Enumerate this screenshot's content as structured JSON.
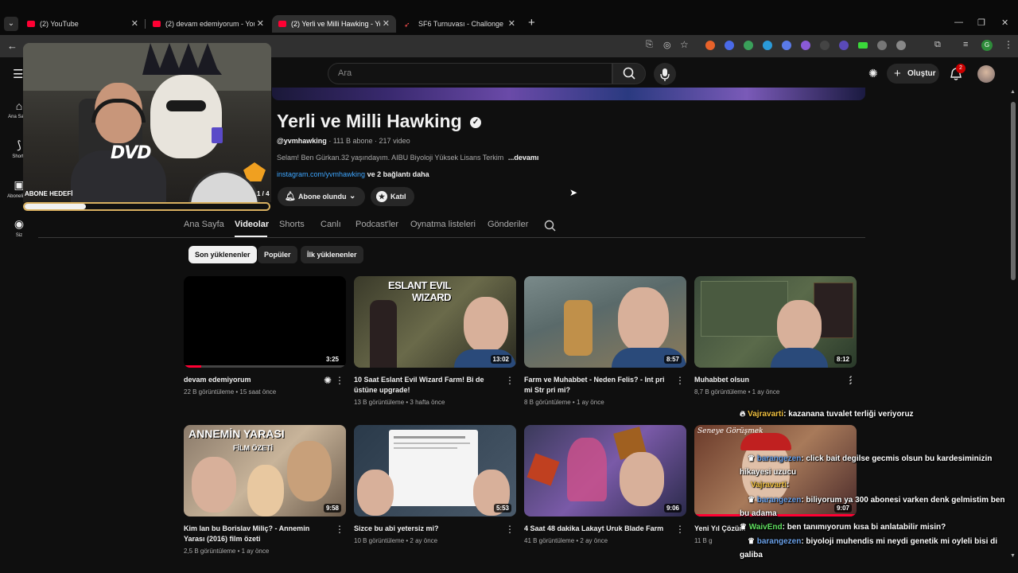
{
  "browser": {
    "tabs": [
      {
        "label": "(2) YouTube"
      },
      {
        "label": "(2) devam edemiyorum - YouTube"
      },
      {
        "label": "(2) Yerli ve Milli Hawking - YouTube"
      },
      {
        "label": "SF6 Turnuvası - Challonge"
      }
    ],
    "close_glyph": "✕",
    "new_tab_glyph": "+"
  },
  "youtube": {
    "search_placeholder": "Ara",
    "create_label": "Oluştur",
    "notification_count": "2",
    "sidebar": [
      {
        "label": "Ana Sayfa",
        "icon": "home-icon"
      },
      {
        "label": "Shorts",
        "icon": "shorts-icon"
      },
      {
        "label": "Abonelikler",
        "icon": "subscriptions-icon"
      },
      {
        "label": "Siz",
        "icon": "you-icon"
      }
    ]
  },
  "overlay": {
    "sub_goal_label": "ABONE HEDEFİ",
    "sub_goal_count": "1 / 4",
    "sub_goal_progress": 0.25,
    "dvd_logo": "DVD"
  },
  "channel": {
    "name": "Yerli ve Milli Hawking",
    "handle": "@yvmhawking",
    "subscribers": "111 B abone",
    "video_count": "217 video",
    "description": "Selam! Ben Gürkan.32 yaşındayım. AIBU Biyoloji Yüksek Lisans Terkim",
    "more": "...devamı",
    "link": "instagram.com/yvmhawking",
    "link_more": "ve 2 bağlantı daha",
    "subscribed_label": "Abone olundu",
    "join_label": "Katıl",
    "tabs": [
      "Ana Sayfa",
      "Videolar",
      "Shorts",
      "Canlı",
      "Podcast'ler",
      "Oynatma listeleri",
      "Gönderiler"
    ],
    "active_tab": "Videolar",
    "chips": [
      "Son yüklenenler",
      "Popüler",
      "İlk yüklenenler"
    ]
  },
  "videos": [
    {
      "title": "devam edemiyorum",
      "views": "22 B görüntüleme",
      "age": "15 saat önce",
      "duration": "3:25",
      "overlay_text": ""
    },
    {
      "title": "10 Saat Eslant Evil Wizard Farm! Bi de üstüne upgrade!",
      "views": "13 B görüntüleme",
      "age": "3 hafta önce",
      "duration": "13:02",
      "overlay_text": "ESLANT EVIL WIZARD"
    },
    {
      "title": "Farm ve Muhabbet - Neden Felis? - Int pri mi Str pri mi?",
      "views": "8 B görüntüleme",
      "age": "1 ay önce",
      "duration": "8:57",
      "overlay_text": ""
    },
    {
      "title": "Muhabbet olsun",
      "views": "8,7 B görüntüleme",
      "age": "1 ay önce",
      "duration": "8:12",
      "overlay_text": ""
    },
    {
      "title": "Kim lan bu Borislav Miliç? - Annemin Yarası (2016) film özeti",
      "views": "2,5 B görüntüleme",
      "age": "1 ay önce",
      "duration": "9:58",
      "overlay_text": "ANNEMİN YARASI"
    },
    {
      "title": "Sizce bu abi yetersiz mi?",
      "views": "10 B görüntüleme",
      "age": "2 ay önce",
      "duration": "5:53",
      "overlay_text": ""
    },
    {
      "title": "4 Saat 48 dakika Lakayt Uruk Blade Farm",
      "views": "41 B görüntüleme",
      "age": "2 ay önce",
      "duration": "9:06",
      "overlay_text": ""
    },
    {
      "title": "Yeni Yıl Çözüm",
      "views": "11 B g",
      "age": "",
      "duration": "9:07",
      "overlay_text": ""
    }
  ],
  "chat": [
    {
      "user": "Vajravarti",
      "text": ": kazanana tuvalet terliği veriyoruz"
    },
    {
      "user": "barangezen",
      "text": ": click bait degilse gecmis olsun bu kardesiminizin hikayesi uzucu"
    },
    {
      "user": "Vajravarti",
      "text": ":"
    },
    {
      "user": "barangezen",
      "text": ": biliyorum ya 300 abonesi varken denk gelmistim ben bu adama"
    },
    {
      "user": "WaivEnd",
      "text": ": ben tanımıyorum kısa bi anlatabilir misin?"
    },
    {
      "user": "barangezen",
      "text": ": biyoloji muhendis mi neydi genetik mi oyleli bisi di galiba"
    }
  ],
  "colors": {
    "accent": "#ff0033",
    "background": "#0f0f0f",
    "link": "#3ea6ff",
    "chip_active": "#f1f1f1"
  }
}
